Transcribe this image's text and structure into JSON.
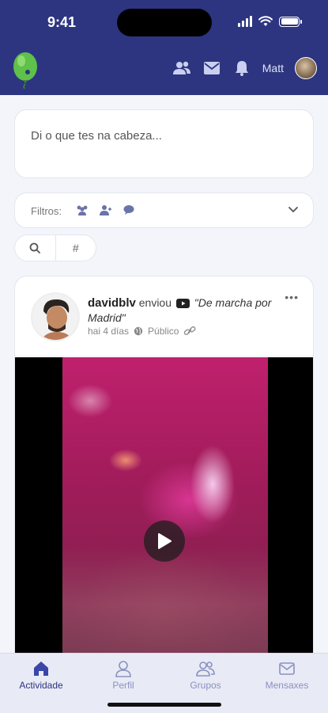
{
  "status_bar": {
    "time": "9:41"
  },
  "header": {
    "logo_icon": "balloon-logo-icon",
    "icons": [
      "friends-icon",
      "mail-icon",
      "bell-icon"
    ],
    "user_name": "Matt",
    "brand_color": "#2d3580"
  },
  "composer": {
    "placeholder": "Di o que tes na cabeza..."
  },
  "filters": {
    "label": "Filtros:",
    "icons": [
      "groups-filter-icon",
      "user-add-filter-icon",
      "comment-filter-icon"
    ]
  },
  "search": {
    "icons": [
      "search-icon",
      "hashtag-icon"
    ],
    "hashtag": "#"
  },
  "post": {
    "user": "davidblv",
    "action": "enviou",
    "title": "\"De marcha por Madrid\"",
    "time": "hai 4 días",
    "visibility": "Público",
    "more": "•••"
  },
  "tabs": [
    {
      "label": "Actividade",
      "icon": "home-icon",
      "active": true
    },
    {
      "label": "Perfil",
      "icon": "profile-icon",
      "active": false
    },
    {
      "label": "Grupos",
      "icon": "groups-icon",
      "active": false
    },
    {
      "label": "Mensaxes",
      "icon": "messages-icon",
      "active": false
    }
  ]
}
